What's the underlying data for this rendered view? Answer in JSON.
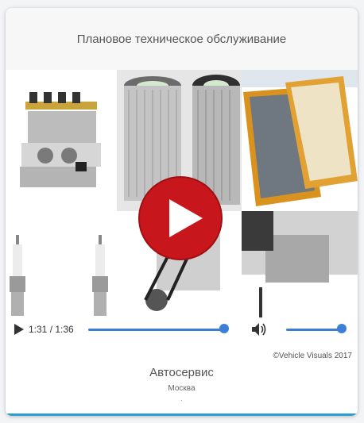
{
  "header": {
    "title": "Плановое техническое обслуживание"
  },
  "player": {
    "time_display": "1:31 / 1:36",
    "progress": 0.948,
    "volume": 0.92,
    "accent_color": "#3d7fd6",
    "play_button_color": "#c8161d",
    "icons": {
      "play": "play-icon",
      "volume": "volume-icon",
      "big_play": "big-play-icon"
    }
  },
  "copyright": "©Vehicle Visuals 2017",
  "organization": {
    "name": "Автосервис",
    "city": "Москва",
    "footer_mark": "."
  }
}
